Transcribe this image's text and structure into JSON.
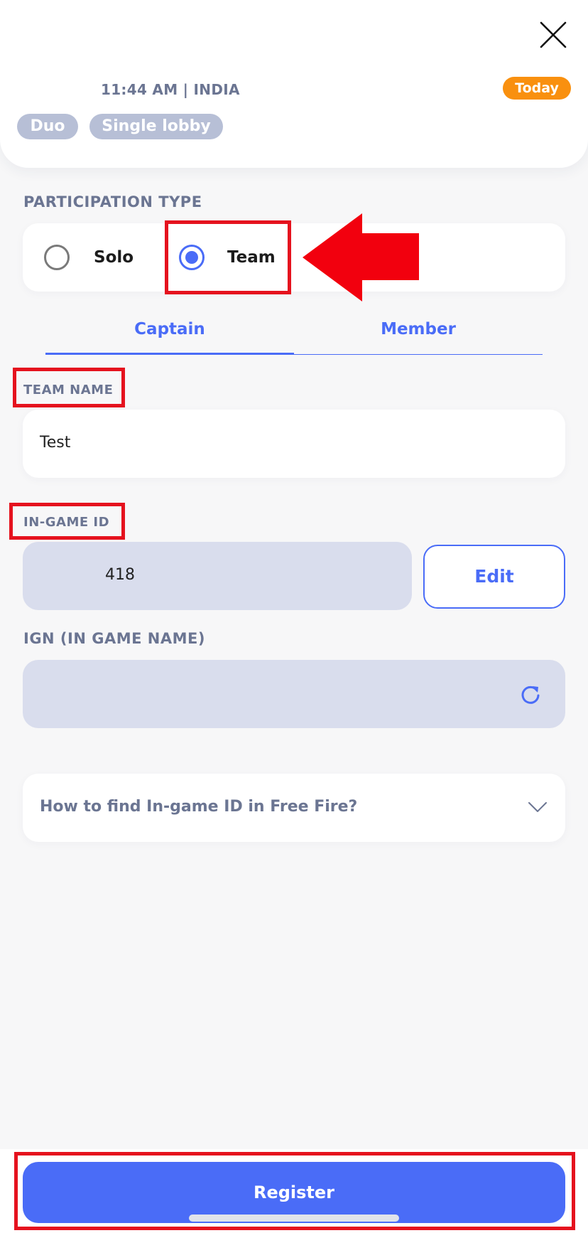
{
  "header": {
    "time_location": "11:44 AM | INDIA",
    "today_badge": "Today",
    "tags": [
      "Duo",
      "Single lobby"
    ]
  },
  "participation": {
    "label": "PARTICIPATION TYPE",
    "options": [
      {
        "label": "Solo",
        "selected": false
      },
      {
        "label": "Team",
        "selected": true
      }
    ]
  },
  "tabs": [
    {
      "label": "Captain",
      "active": true
    },
    {
      "label": "Member",
      "active": false
    }
  ],
  "form": {
    "team_name_label": "TEAM NAME",
    "team_name_value": "Test",
    "in_game_id_label": "IN-GAME ID",
    "in_game_id_value": "418",
    "edit_label": "Edit",
    "ign_label": "IGN (IN GAME NAME)",
    "ign_value": ""
  },
  "faq": {
    "question": "How to find In-game ID in Free Fire?"
  },
  "footer": {
    "register_label": "Register"
  },
  "icons": {
    "close": "close-icon",
    "refresh": "refresh-icon",
    "chevron": "chevron-down-icon",
    "annotation_arrow": "arrow-left-icon"
  },
  "colors": {
    "accent": "#4a6cf7",
    "badge": "#f9900f",
    "highlight": "#e5121e",
    "label": "#6b7592",
    "tag": "#b7bfd6",
    "disabled_input": "#d9dded"
  }
}
